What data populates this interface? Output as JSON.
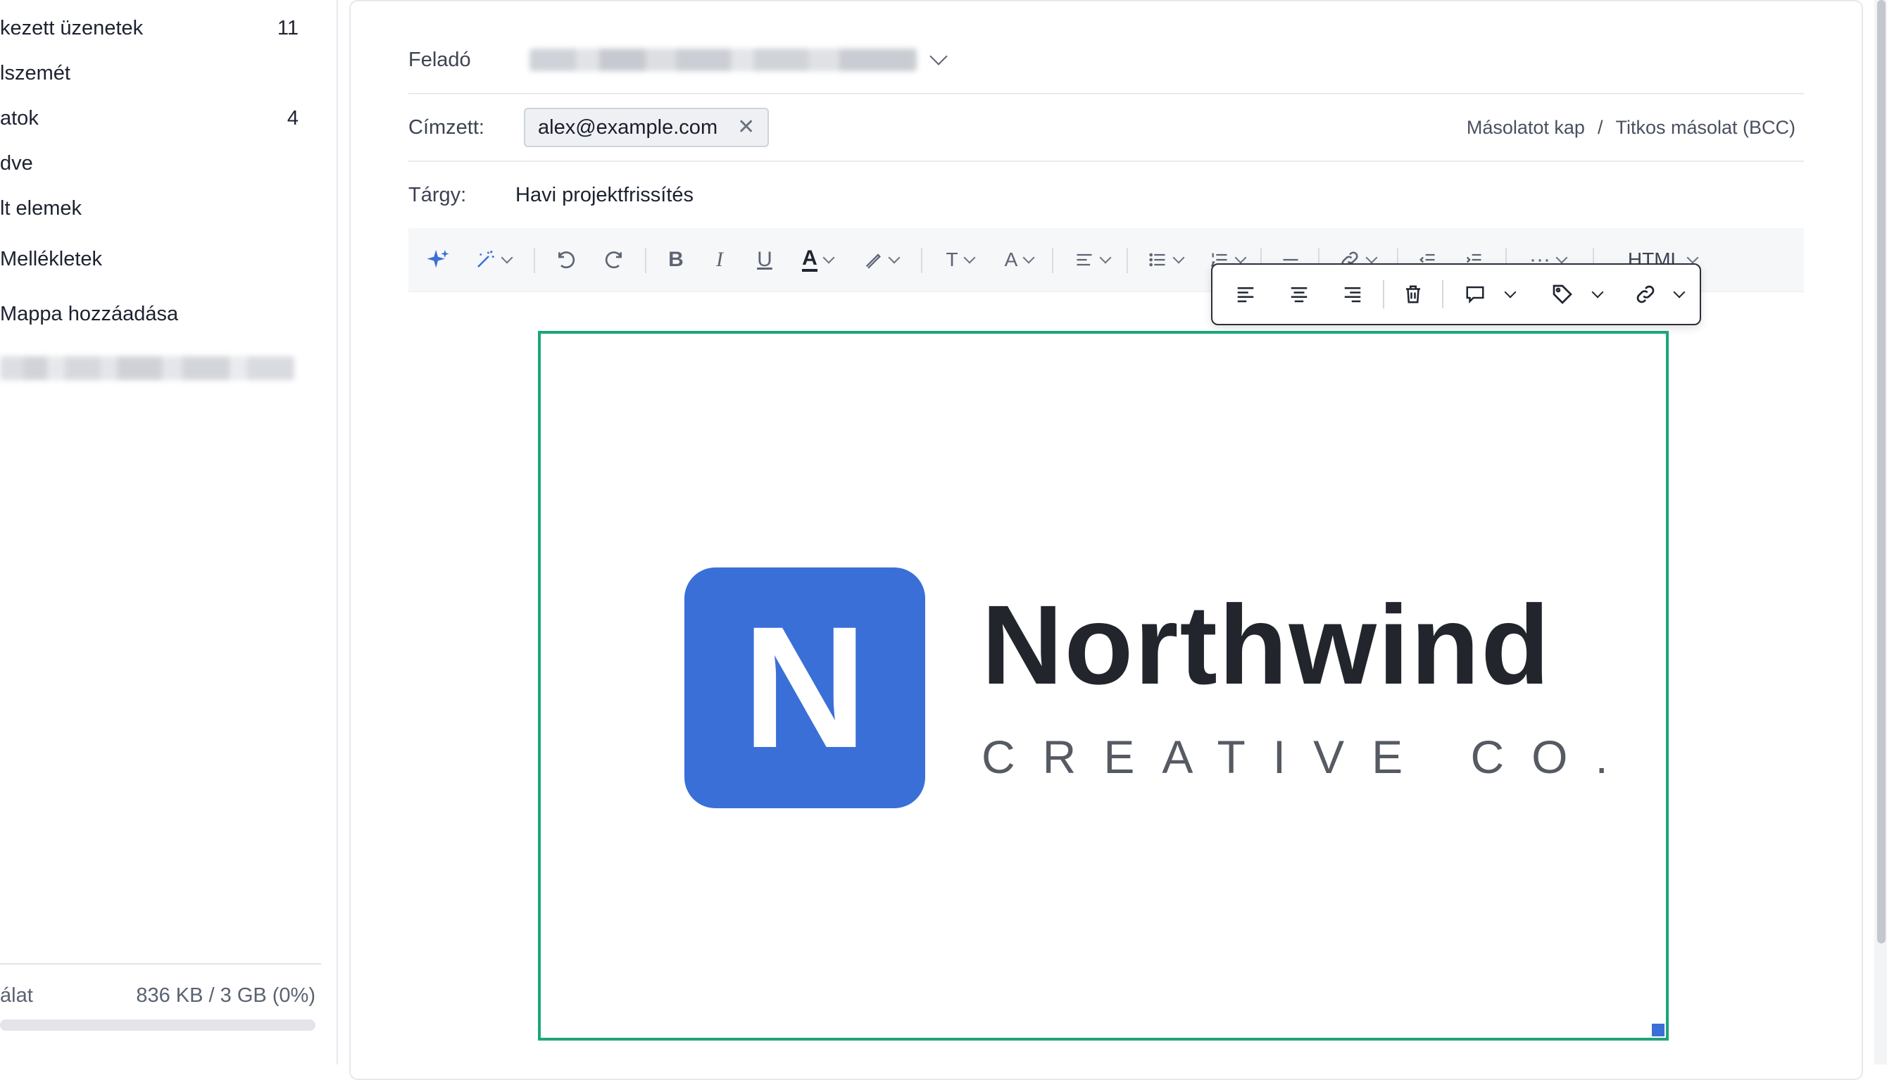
{
  "sidebar": {
    "items": [
      {
        "label": "kezett üzenetek",
        "count": "11"
      },
      {
        "label": "lszemét",
        "count": ""
      },
      {
        "label": "atok",
        "count": "4"
      },
      {
        "label": "dve",
        "count": ""
      },
      {
        "label": "lt elemek",
        "count": ""
      },
      {
        "label": "Mellékletek",
        "count": ""
      },
      {
        "label": "Mappa hozzáadása",
        "count": ""
      }
    ],
    "quota": {
      "label": "álat",
      "value": "836 KB / 3 GB (0%)",
      "percent": 0
    }
  },
  "compose": {
    "from_label": "Feladó",
    "to_label": "Címzett:",
    "recipient": "alex@example.com",
    "cc_label": "Másolatot kap",
    "cc_sep": "/",
    "bcc_label": "Titkos másolat (BCC)",
    "subject_label": "Tárgy:",
    "subject": "Havi projektfrissítés"
  },
  "toolbar": {
    "mode_label": "HTML",
    "more_label": "···"
  },
  "image": {
    "logo_letter": "N",
    "brand_name": "Northwind",
    "brand_sub": "CREATIVE CO.",
    "brand_color": "#3a6fd8",
    "selection_color": "#1ea57a"
  }
}
